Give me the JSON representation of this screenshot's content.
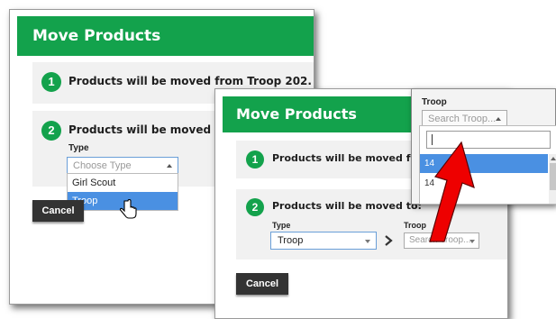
{
  "dialog1": {
    "title": "Move Products",
    "step1": {
      "number": "1",
      "text": "Products will be moved from Troop 202."
    },
    "step2": {
      "number": "2",
      "text": "Products will be moved to:"
    },
    "type_label": "Type",
    "type_placeholder": "Choose Type",
    "options": [
      "Girl Scout",
      "Troop"
    ],
    "cancel_label": "Cancel"
  },
  "dialog2": {
    "title": "Move Products",
    "step1": {
      "number": "1",
      "text": "Products will be moved from"
    },
    "step2": {
      "number": "2",
      "text": "Products will be moved to:"
    },
    "type_label": "Type",
    "type_value": "Troop",
    "troop_label": "Troop",
    "troop_placeholder": "Search Troop...",
    "cancel_label": "Cancel"
  },
  "troop_dropdown": {
    "label": "Troop",
    "placeholder": "Search Troop...",
    "search_value": "",
    "options": [
      "14",
      "14"
    ]
  },
  "colors": {
    "brand_green": "#13a24c",
    "highlight_blue": "#4a90e2",
    "arrow_red": "#ee0000"
  }
}
